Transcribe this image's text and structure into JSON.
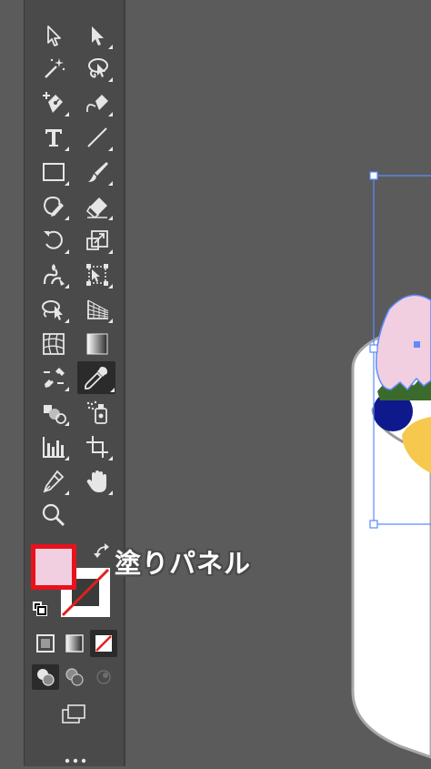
{
  "annotation": {
    "label": "塗りパネル",
    "highlight_color": "#e8121b"
  },
  "colors": {
    "fill": "#f2cfe0",
    "stroke": "none",
    "selection": "#5b8cff"
  },
  "tools": [
    {
      "name": "selection-tool-icon"
    },
    {
      "name": "direct-selection-tool-icon"
    },
    {
      "name": "magic-wand-tool-icon"
    },
    {
      "name": "lasso-tool-icon"
    },
    {
      "name": "pen-tool-icon"
    },
    {
      "name": "curvature-tool-icon"
    },
    {
      "name": "type-tool-icon"
    },
    {
      "name": "line-segment-tool-icon"
    },
    {
      "name": "rectangle-tool-icon"
    },
    {
      "name": "paintbrush-tool-icon"
    },
    {
      "name": "shaper-tool-icon"
    },
    {
      "name": "eraser-tool-icon"
    },
    {
      "name": "rotate-tool-icon"
    },
    {
      "name": "scale-tool-icon"
    },
    {
      "name": "warp-tool-icon"
    },
    {
      "name": "free-transform-tool-icon"
    },
    {
      "name": "shape-builder-tool-icon"
    },
    {
      "name": "perspective-grid-tool-icon"
    },
    {
      "name": "mesh-tool-icon"
    },
    {
      "name": "gradient-tool-icon"
    },
    {
      "name": "blend-tool-icon"
    },
    {
      "name": "eyedropper-tool-icon"
    },
    {
      "name": "symbol-sprayer-tool-icon"
    },
    {
      "name": "column-graph-tool-icon"
    },
    {
      "name": "artboard-tool-icon"
    },
    {
      "name": "slice-tool-icon"
    },
    {
      "name": "hand-tool-icon"
    },
    {
      "name": "zoom-tool-icon"
    }
  ],
  "active_tool": "eyedropper-tool-icon"
}
